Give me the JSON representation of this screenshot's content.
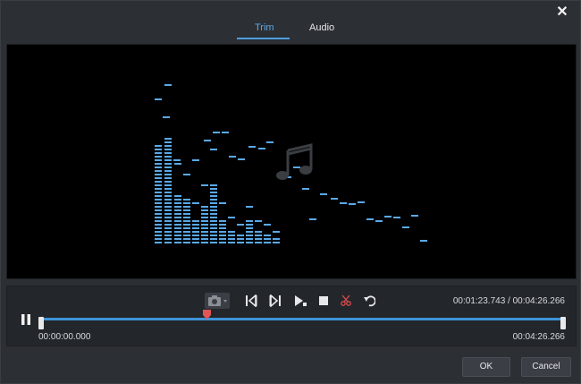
{
  "window": {
    "close_label": "✕"
  },
  "tabs": [
    {
      "label": "Trim",
      "active": true
    },
    {
      "label": "Audio",
      "active": false
    }
  ],
  "playback": {
    "current_time": "00:01:23.743",
    "separator": " / ",
    "total_time": "00:04:26.266",
    "time_display": "00:01:23.743 / 00:04:26.266",
    "start_time": "00:00:00.000",
    "end_time": "00:04:26.266",
    "playhead_fraction": 0.3145
  },
  "toolbar": {
    "icons": [
      "camera-icon",
      "prev-frame-icon",
      "next-frame-icon",
      "play-segment-icon",
      "stop-icon",
      "cut-icon",
      "undo-icon"
    ]
  },
  "buttons": {
    "ok_label": "OK",
    "cancel_label": "Cancel"
  },
  "colors": {
    "accent": "#4f9fe0",
    "eq_bar": "#5aa9e8",
    "playhead": "#e05555"
  }
}
